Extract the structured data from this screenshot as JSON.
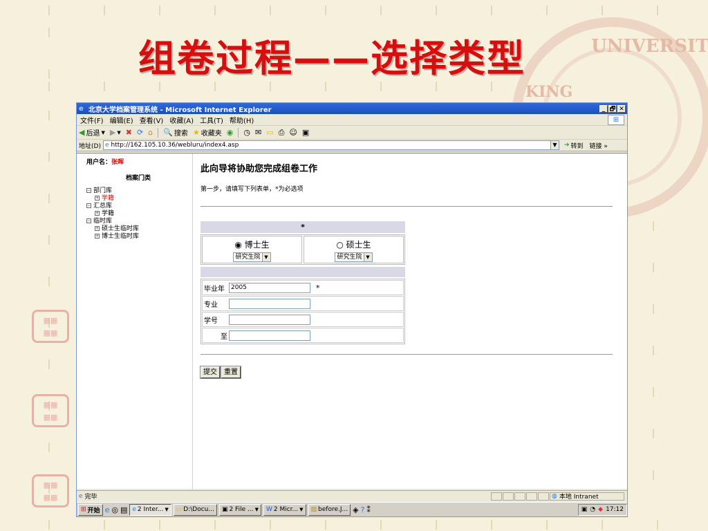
{
  "slide": {
    "title": "组卷过程——选择类型",
    "seal_text": "UNIVERSITY",
    "seal_text_side": "KING"
  },
  "window": {
    "title": "北京大学档案管理系统 - Microsoft Internet Explorer",
    "controls": [
      "_",
      "🗗",
      "✕"
    ]
  },
  "menu": [
    "文件(F)",
    "编辑(E)",
    "查看(V)",
    "收藏(A)",
    "工具(T)",
    "帮助(H)"
  ],
  "toolbar": {
    "back": "后退",
    "search": "搜索",
    "favorites": "收藏夹"
  },
  "address": {
    "label": "地址(D)",
    "url": "http://162.105.10.36/webluru/index4.asp",
    "go": "转到",
    "links": "链接 »"
  },
  "left": {
    "user_label": "用户名：",
    "user_name": "张晖",
    "tree_title": "档案门类",
    "tree": [
      {
        "label": "部门库",
        "children": [
          {
            "label": "学籍",
            "red": true
          }
        ]
      },
      {
        "label": "汇总库",
        "children": [
          {
            "label": "学籍",
            "red": false
          }
        ]
      },
      {
        "label": "临时库",
        "children": [
          {
            "label": "硕士生临时库",
            "red": false
          },
          {
            "label": "博士生临时库",
            "red": false
          }
        ]
      }
    ]
  },
  "wizard": {
    "title": "此向导将协助您完成组卷工作",
    "step": "第一步，请填写下列表单，*为必选项",
    "header_mark": "*",
    "options": [
      {
        "label": "博士生",
        "checked": true,
        "select": "研究生院"
      },
      {
        "label": "硕士生",
        "checked": false,
        "select": "研究生院"
      }
    ],
    "fields": [
      {
        "label": "毕业年",
        "value": "2005",
        "required": "*"
      },
      {
        "label": "专业",
        "value": "",
        "required": ""
      },
      {
        "label": "学号",
        "value": "",
        "required": ""
      },
      {
        "label": "至",
        "value": "",
        "required": ""
      }
    ],
    "submit": "提交",
    "reset": "重置"
  },
  "status": {
    "text": "完毕",
    "zone": "本地 Intranet"
  },
  "taskbar": {
    "start": "开始",
    "tasks": [
      "2 Inter...",
      "D:\\Docu...",
      "2 File ...",
      "2 Micr...",
      "before.J..."
    ],
    "clock": "17:12"
  }
}
